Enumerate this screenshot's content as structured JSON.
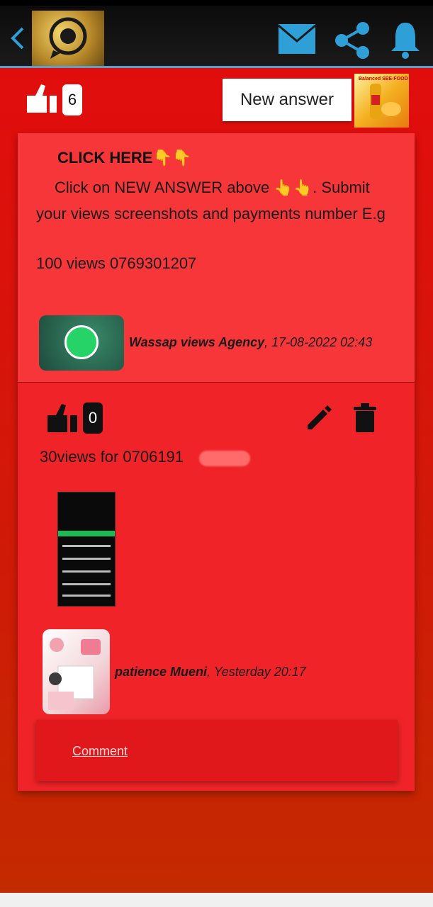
{
  "header": {
    "back_icon": "chevron-left-icon",
    "logo_icon": "whatsapp-gold-logo",
    "mail_icon": "mail-icon",
    "share_icon": "share-icon",
    "bell_icon": "bell-icon",
    "accent_color": "#2f9fd8"
  },
  "question": {
    "like_count": "6",
    "new_answer_label": "New answer",
    "ad_label": "Balanced SEE-FOOD"
  },
  "post1": {
    "heading": "CLICK HERE👇👇",
    "line1": "Click on NEW ANSWER above 👆👆. Submit your views screenshots and payments number E.g",
    "line2": "100 views 0769301207",
    "author": "Wassap views Agency",
    "date": ", 17-08-2022 02:43"
  },
  "post2": {
    "like_count": "0",
    "text": "30views for 0706191",
    "author": "patience Mueni",
    "date": ", Yesterday 20:17",
    "comment_label": "Comment"
  }
}
